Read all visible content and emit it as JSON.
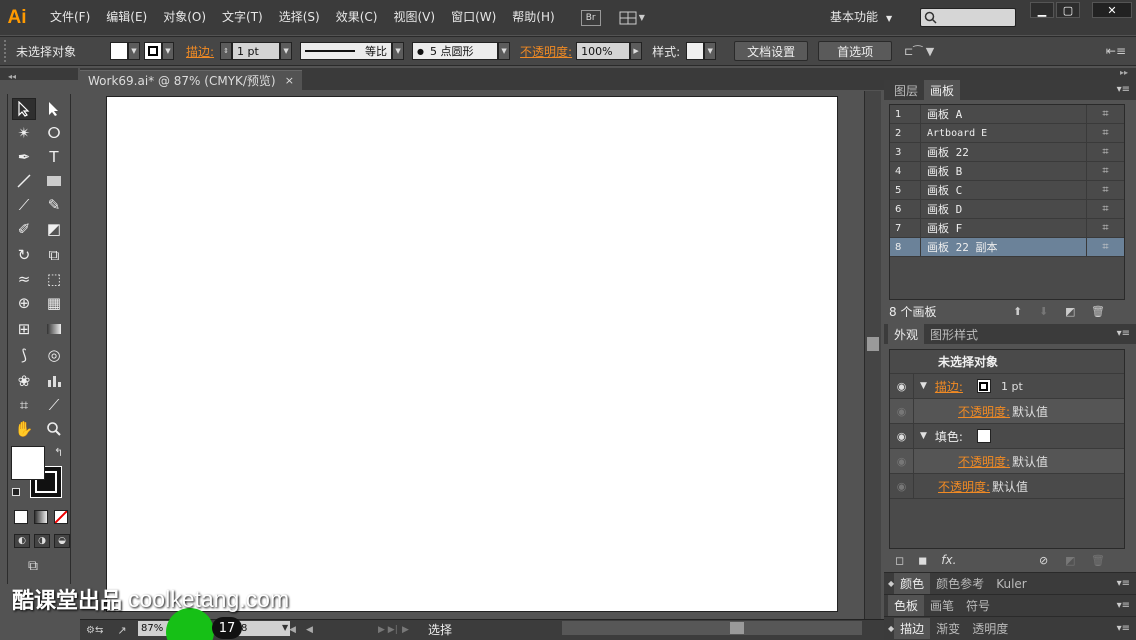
{
  "app": {
    "logo": "Ai",
    "menu": [
      "文件(F)",
      "编辑(E)",
      "对象(O)",
      "文字(T)",
      "选择(S)",
      "效果(C)",
      "视图(V)",
      "窗口(W)",
      "帮助(H)"
    ],
    "bridge_label": "Br",
    "workspace": "基本功能",
    "window_buttons": [
      "▁",
      "▢",
      "✕"
    ]
  },
  "controlbar": {
    "selection": "未选择对象",
    "stroke_label": "描边:",
    "stroke_weight": "1 pt",
    "profile": "等比",
    "brush": "5 点圆形",
    "opacity_label": "不透明度:",
    "opacity": "100%",
    "style_label": "样式:",
    "doc_setup": "文档设置",
    "preferences": "首选项"
  },
  "document": {
    "tab_title": "Work69.ai* @ 87% (CMYK/预览)",
    "close": "×"
  },
  "status": {
    "zoom": "87%",
    "page": "8",
    "tool": "选择",
    "badge": "17"
  },
  "watermark": {
    "cn": "酷课堂出品",
    "en": "coolketang.com"
  },
  "artboards_panel": {
    "tabs": [
      "图层",
      "画板"
    ],
    "rows": [
      {
        "num": "1",
        "name": "画板 A"
      },
      {
        "num": "2",
        "name": "Artboard E"
      },
      {
        "num": "3",
        "name": "画板 22"
      },
      {
        "num": "4",
        "name": "画板 B"
      },
      {
        "num": "5",
        "name": "画板 C"
      },
      {
        "num": "6",
        "name": "画板 D"
      },
      {
        "num": "7",
        "name": "画板 F"
      },
      {
        "num": "8",
        "name": "画板 22 副本"
      }
    ],
    "count": "8 个画板"
  },
  "appearance_panel": {
    "tabs": [
      "外观",
      "图形样式"
    ],
    "header": "未选择对象",
    "stroke_label": "描边:",
    "stroke_weight": "1 pt",
    "opacity_label": "不透明度:",
    "opacity_value": "默认值",
    "fill_label": "填色:",
    "fx": "fx."
  },
  "collapsed_panels": {
    "color": [
      "颜色",
      "颜色参考",
      "Kuler"
    ],
    "swatch": [
      "色板",
      "画笔",
      "符号"
    ],
    "stroke": [
      "描边",
      "渐变",
      "透明度"
    ]
  }
}
